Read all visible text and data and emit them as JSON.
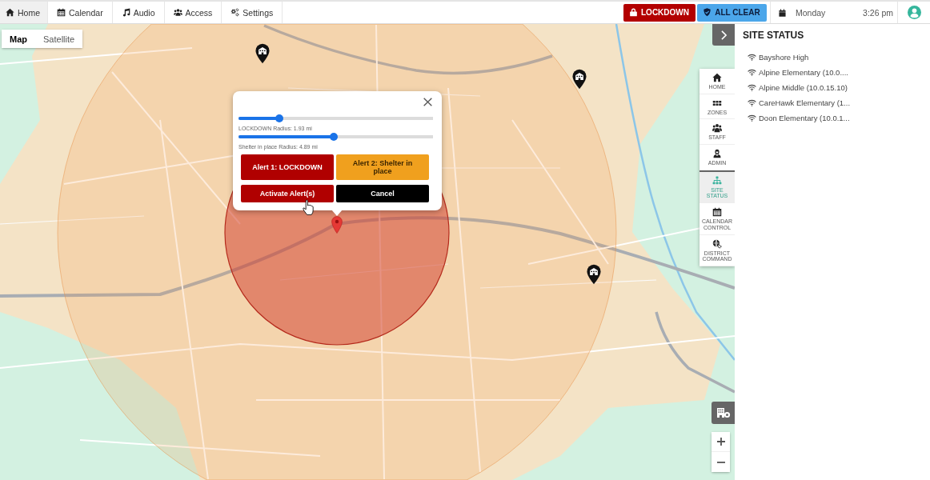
{
  "nav": {
    "tabs": [
      {
        "label": "Home",
        "selected": true
      },
      {
        "label": "Calendar",
        "selected": false
      },
      {
        "label": "Audio",
        "selected": false
      },
      {
        "label": "Access",
        "selected": false
      },
      {
        "label": "Settings",
        "selected": false
      }
    ],
    "alert_buttons": [
      {
        "label": "LOCKDOWN",
        "kind": "lockdown"
      },
      {
        "label": "ALL CLEAR",
        "kind": "all_clear"
      }
    ],
    "day": "Monday",
    "time": "3:26 pm"
  },
  "map": {
    "view_toggle": [
      {
        "label": "Map",
        "selected": true
      },
      {
        "label": "Satellite",
        "selected": false
      }
    ],
    "popup": {
      "sliders": [
        {
          "level": 0.21,
          "caption": "LOCKDOWN Radius: 1.93 mi"
        },
        {
          "level": 0.49,
          "caption": "Shelter in place Radius: 4.89 mi"
        }
      ],
      "buttons": [
        {
          "label": "Alert 1: LOCKDOWN",
          "kind": "lockdown"
        },
        {
          "label": "Alert 2: Shelter in place",
          "kind": "shelter"
        },
        {
          "label": "Activate Alert(s)",
          "kind": "activate"
        },
        {
          "label": "Cancel",
          "kind": "cancel"
        }
      ]
    }
  },
  "side_toolbar": [
    {
      "label": "HOME",
      "selected": false
    },
    {
      "label": "ZONES",
      "selected": false
    },
    {
      "label": "STAFF",
      "selected": false
    },
    {
      "label": "ADMIN",
      "selected": false
    },
    {
      "label": "SITE STATUS",
      "selected": true
    },
    {
      "label": "CALENDAR CONTROL",
      "selected": false
    },
    {
      "label": "DISTRICT COMMAND",
      "selected": false
    }
  ],
  "site_status": {
    "title": "SITE STATUS",
    "sites": [
      "Bayshore High",
      "Alpine Elementary (10.0....",
      "Alpine Middle (10.0.15.10)",
      "CareHawk Elementary (1...",
      "Doon Elementary (10.0.1..."
    ]
  }
}
